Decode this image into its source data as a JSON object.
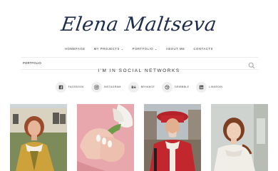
{
  "site": {
    "logo_text": "Elena Maltseva"
  },
  "nav": {
    "items": [
      {
        "label": "HOMEPAGE",
        "has_dropdown": false
      },
      {
        "label": "MY PROJECTS",
        "has_dropdown": true
      },
      {
        "label": "PORTFOLIO",
        "has_dropdown": true
      },
      {
        "label": "ABOUT ME",
        "has_dropdown": false
      },
      {
        "label": "CONTACTS",
        "has_dropdown": false
      }
    ]
  },
  "breadcrumb": {
    "label": "PORTFOLIO"
  },
  "social": {
    "title": "I'M IN SOCIAL NETWORKS",
    "items": [
      {
        "label": "FACEBOOK",
        "icon": "facebook-icon"
      },
      {
        "label": "INSTAGRAM",
        "icon": "instagram-icon"
      },
      {
        "label": "BEHANCE",
        "icon": "behance-icon"
      },
      {
        "label": "DRIBBBLE",
        "icon": "dribbble-icon"
      },
      {
        "label": "LINKEDIN",
        "icon": "linkedin-icon"
      }
    ]
  },
  "colors": {
    "logo": "#1d2b4c",
    "social_bg": "#efefef",
    "divider": "#ececec"
  }
}
